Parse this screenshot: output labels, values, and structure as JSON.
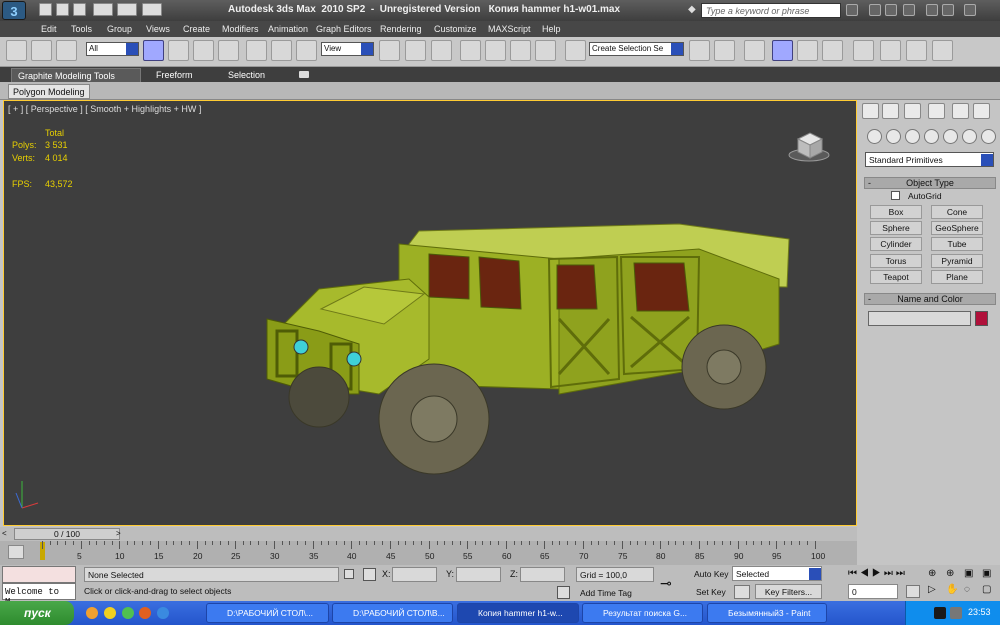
{
  "titlebar": {
    "title": "Autodesk 3ds Max  2010 SP2  -  Unregistered Version   Копия hammer h1-w01.max",
    "search_placeholder": "Type a keyword or phrase",
    "logo": "3"
  },
  "menu": [
    "Edit",
    "Tools",
    "Group",
    "Views",
    "Create",
    "Modifiers",
    "Animation",
    "Graph Editors",
    "Rendering",
    "Customize",
    "MAXScript",
    "Help"
  ],
  "toolbar": {
    "filter": "All",
    "ref_coord": "View",
    "selection_set": "Create Selection Se"
  },
  "ribbon": {
    "tabs": [
      "Graphite Modeling Tools",
      "Freeform",
      "Selection"
    ],
    "subtab": "Polygon Modeling"
  },
  "viewport": {
    "label": "[ + ] [ Perspective ] [ Smooth + Highlights + HW ]",
    "stats": {
      "total_label": "Total",
      "polys_label": "Polys:",
      "polys": "3 531",
      "verts_label": "Verts:",
      "verts": "4 014",
      "fps_label": "FPS:",
      "fps": "43,572"
    },
    "body_color": "#9cb024",
    "border_color": "#ffcc33"
  },
  "command_panel": {
    "category": "Standard Primitives",
    "object_type_title": "Object Type",
    "autogrid": "AutoGrid",
    "buttons": [
      "Box",
      "Cone",
      "Sphere",
      "GeoSphere",
      "Cylinder",
      "Tube",
      "Torus",
      "Pyramid",
      "Teapot",
      "Plane"
    ],
    "name_color_title": "Name and Color",
    "swatch_color": "#b0103a"
  },
  "timeline": {
    "frame": "0 / 100",
    "ticks": [
      "0",
      "5",
      "10",
      "15",
      "20",
      "25",
      "30",
      "35",
      "40",
      "45",
      "50",
      "55",
      "60",
      "65",
      "70",
      "75",
      "80",
      "85",
      "90",
      "95",
      "100"
    ]
  },
  "status": {
    "maxscript": "Welcome to M.",
    "selection": "None Selected",
    "prompt": "Click or click-and-drag to select objects",
    "x_label": "X:",
    "y_label": "Y:",
    "z_label": "Z:",
    "grid": "Grid = 100,0",
    "add_time_tag": "Add Time Tag",
    "auto_key": "Auto Key",
    "key_mode": "Selected",
    "set_key": "Set Key",
    "key_filters": "Key Filters...",
    "current_frame": "0"
  },
  "taskbar": {
    "start": "пуск",
    "tasks": [
      "D:\\РАБОЧИЙ СТОЛ\\...",
      "D:\\РАБОЧИЙ СТОЛ\\В...",
      "Копия hammer h1-w...",
      "Результат поиска G...",
      "Безымянный3 - Paint"
    ],
    "lang": "EN",
    "clock": "23:53"
  }
}
